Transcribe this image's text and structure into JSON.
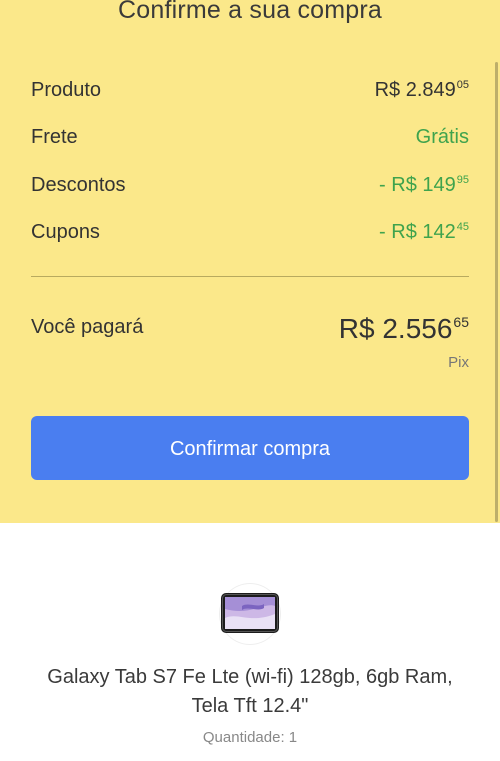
{
  "summary": {
    "title": "Confirme a sua compra",
    "rows": [
      {
        "label": "Produto",
        "value_main": "R$ 2.849",
        "value_cents": "05",
        "accent": "#333333"
      },
      {
        "label": "Frete",
        "value_main": "Grátis",
        "value_cents": "",
        "accent": "#3fa34d"
      },
      {
        "label": "Descontos",
        "value_main": "- R$ 149",
        "value_cents": "95",
        "accent": "#3fa34d"
      },
      {
        "label": "Cupons",
        "value_main": "- R$ 142",
        "value_cents": "45",
        "accent": "#3fa34d"
      }
    ],
    "total_label": "Você pagará",
    "total_main": "R$ 2.556",
    "total_cents": "65",
    "payment_method": "Pix",
    "confirm_label": "Confirmar compra",
    "background_color": "#fbe88a",
    "button_color": "#4a7ef0"
  },
  "product": {
    "image_icon": "tablet-icon",
    "name_line1": "Galaxy Tab S7 Fe Lte (wi-fi) 128gb, 6gb Ram,",
    "name_line2": "Tela Tft 12.4\"",
    "quantity": "Quantidade: 1"
  }
}
